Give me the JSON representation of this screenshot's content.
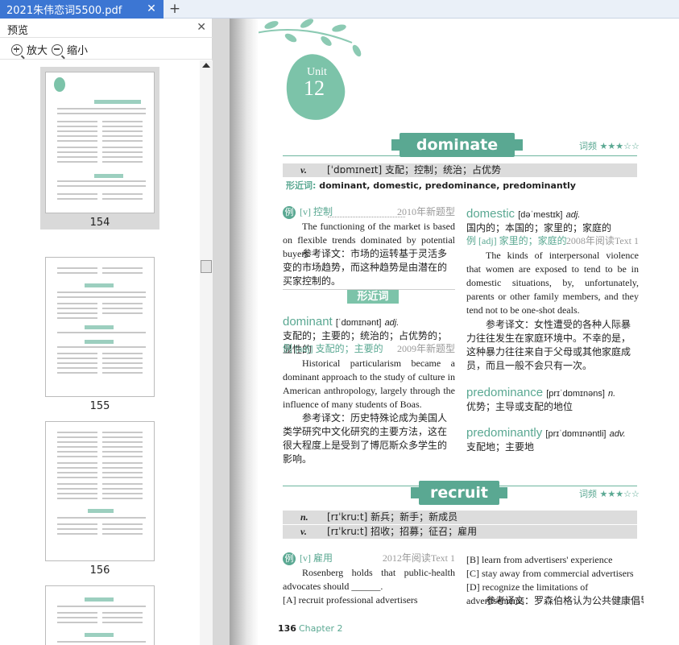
{
  "tab": {
    "title": "2021朱伟恋词5500.pdf",
    "close": "✕",
    "add": "+"
  },
  "sidebar": {
    "title": "预览",
    "close": "✕",
    "zoom_in": "放大",
    "zoom_out": "缩小",
    "pages": [
      "154",
      "155",
      "156"
    ]
  },
  "page": {
    "unit_label": "Unit",
    "unit_number": "12",
    "word1": {
      "title": "dominate",
      "freq": "词频 ★★★☆☆",
      "pos": "v.",
      "def": "[ˈdɒmɪneɪt] 支配；控制；统治；占优势",
      "syn_label": "形近词:",
      "syn_words": "dominant, domestic, predominance, predominantly"
    },
    "ex1": {
      "badge": "例",
      "tag": "[v] 控制",
      "source": "2010年新题型",
      "en": "The functioning of the market is based on flexible trends dominated by potential buyers.",
      "cn_label": "参考译文：",
      "cn": "市场的运转基于灵活多变的市场趋势，而这种趋势是由潜在的买家控制的。"
    },
    "xingjin_banner": "形近词",
    "dominant": {
      "word": "dominant",
      "phon": "[ˈdɒmɪnənt]",
      "pos": "adj.",
      "def": "支配的；主要的；统治的；占优势的；显性的",
      "ex_badge": "例",
      "ex_tag": "[adj] 支配的；主要的",
      "ex_source": "2009年新题型",
      "en": "Historical particularism became a dominant approach to the study of culture in American anthropology, largely through the influence of many students of Boas.",
      "cn_label": "参考译文：",
      "cn": "历史特殊论成为美国人类学研究中文化研究的主要方法，这在很大程度上是受到了博厄斯众多学生的影响。"
    },
    "domestic": {
      "word": "domestic",
      "phon": "[dəˈmestɪk]",
      "pos": "adj.",
      "def": "国内的；本国的；家里的；家庭的",
      "ex_badge": "例",
      "ex_tag": "[adj] 家里的；家庭的",
      "ex_source": "2008年阅读Text 1",
      "en": "The kinds of interpersonal violence that women are exposed to tend to be in domestic situations, by, unfortunately, parents or other family members, and they tend not to be one-shot deals.",
      "cn_label": "参考译文：",
      "cn": "女性遭受的各种人际暴力往往发生在家庭环境中。不幸的是，这种暴力往往来自于父母或其他家庭成员，而且一般不会只有一次。"
    },
    "predominance": {
      "word": "predominance",
      "phon": "[prɪˈdɒmɪnəns]",
      "pos": "n.",
      "def": "优势；主导或支配的地位"
    },
    "predominantly": {
      "word": "predominantly",
      "phon": "[prɪˈdɒmɪnəntli]",
      "pos": "adv.",
      "def": "支配地；主要地"
    },
    "word2": {
      "title": "recruit",
      "freq": "词频 ★★★☆☆",
      "pos1": "n.",
      "def1": "[rɪˈkruːt] 新兵；新手；新成员",
      "pos2": "v.",
      "def2": "[rɪˈkruːt] 招收；招募；征召；雇用"
    },
    "ex2": {
      "badge": "例",
      "tag": "[v] 雇用",
      "source": "2012年阅读Text 1",
      "en": "Rosenberg holds that public-health advocates should ______.",
      "opt_a": "[A] recruit professional advertisers",
      "opt_b": "[B] learn from advertisers' experience",
      "opt_c": "[C] stay away from commercial advertisers",
      "opt_d": "[D] recognize the limitations of advertisements",
      "cn": "参考译文：罗森伯格认为公共健康倡导"
    },
    "footer_page": "136",
    "footer_chapter": "Chapter 2"
  },
  "colors": {
    "accent": "#5aa892",
    "tab": "#3c76d3"
  }
}
